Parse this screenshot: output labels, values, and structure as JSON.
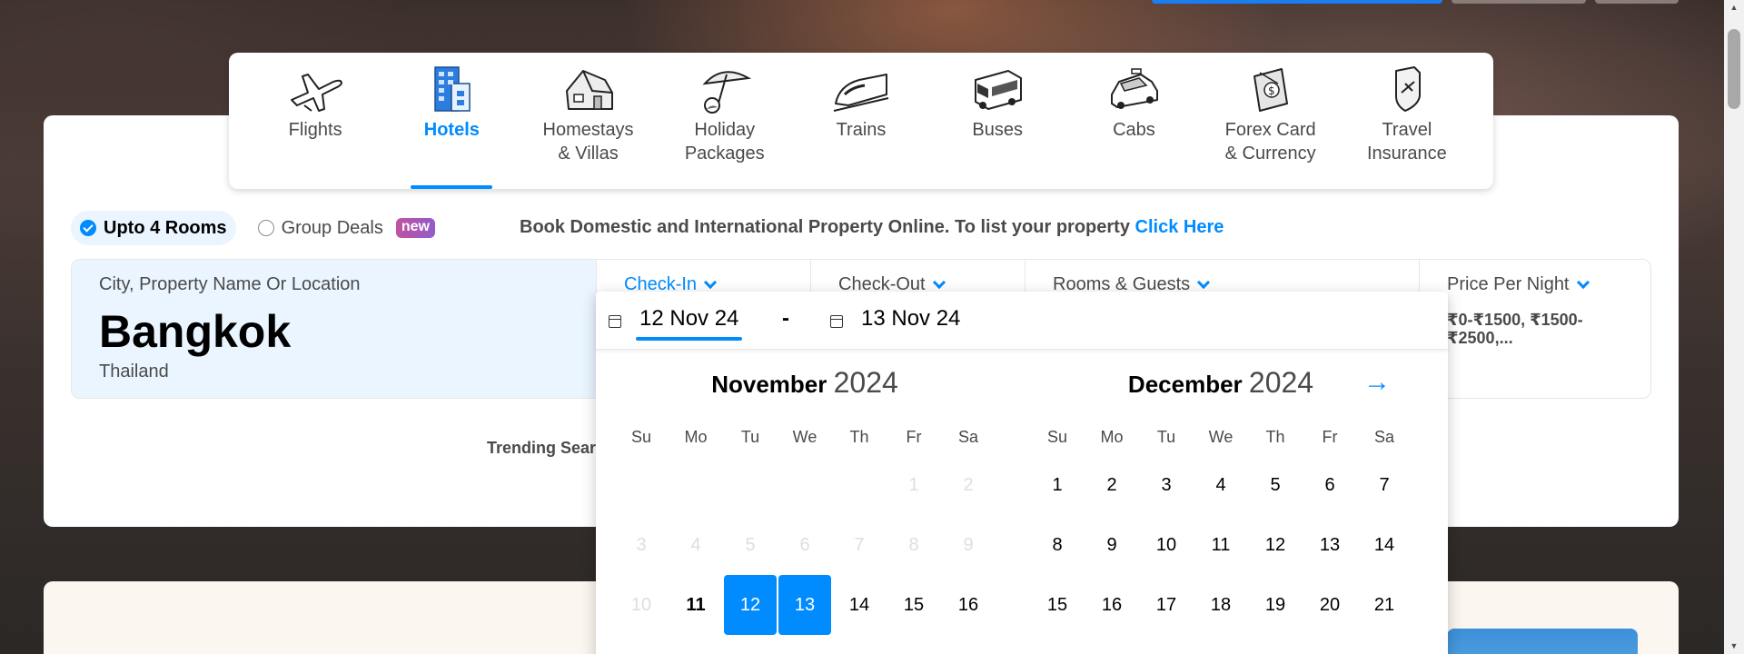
{
  "colors": {
    "accent": "#008cff",
    "pill_bg": "#eaf5ff",
    "text": "#4a4a4a"
  },
  "nav": {
    "tabs": [
      {
        "label": "Flights",
        "icon": "airplane-icon",
        "active": false
      },
      {
        "label": "Hotels",
        "icon": "hotel-building-icon",
        "active": true
      },
      {
        "label": "Homestays\n& Villas",
        "icon": "house-icon",
        "active": false
      },
      {
        "label": "Holiday\nPackages",
        "icon": "beach-umbrella-icon",
        "active": false
      },
      {
        "label": "Trains",
        "icon": "train-icon",
        "active": false
      },
      {
        "label": "Buses",
        "icon": "bus-icon",
        "active": false
      },
      {
        "label": "Cabs",
        "icon": "car-icon",
        "active": false
      },
      {
        "label": "Forex Card\n& Currency",
        "icon": "forex-card-icon",
        "active": false
      },
      {
        "label": "Travel\nInsurance",
        "icon": "insurance-shield-icon",
        "active": false
      }
    ]
  },
  "options": {
    "rooms_label": "Upto 4 Rooms",
    "group_label": "Group Deals",
    "new_badge": "new",
    "promo_text": "Book Domestic and International Property Online. To list your property",
    "promo_link": "Click Here"
  },
  "search": {
    "city_label": "City, Property Name Or Location",
    "city": "Bangkok",
    "country": "Thailand",
    "checkin_label": "Check-In",
    "checkout_label": "Check-Out",
    "rooms_label": "Rooms & Guests",
    "price_label": "Price Per Night",
    "price_value": "₹0-₹1500, ₹1500-₹2500,..."
  },
  "trending_label": "Trending Searc",
  "datepicker": {
    "checkin": "12 Nov 24",
    "separator": "-",
    "checkout": "13 Nov 24",
    "weekdays": [
      "Su",
      "Mo",
      "Tu",
      "We",
      "Th",
      "Fr",
      "Sa"
    ],
    "months": [
      {
        "name": "November",
        "year": "2024",
        "weeks": [
          [
            null,
            null,
            null,
            null,
            null,
            {
              "d": "1",
              "s": "disabled"
            },
            {
              "d": "2",
              "s": "disabled"
            }
          ],
          [
            {
              "d": "3",
              "s": "disabled"
            },
            {
              "d": "4",
              "s": "disabled"
            },
            {
              "d": "5",
              "s": "disabled"
            },
            {
              "d": "6",
              "s": "disabled"
            },
            {
              "d": "7",
              "s": "disabled"
            },
            {
              "d": "8",
              "s": "disabled"
            },
            {
              "d": "9",
              "s": "disabled"
            }
          ],
          [
            {
              "d": "10",
              "s": "disabled"
            },
            {
              "d": "11",
              "s": "today"
            },
            {
              "d": "12",
              "s": "selected"
            },
            {
              "d": "13",
              "s": "selected"
            },
            {
              "d": "14",
              "s": ""
            },
            {
              "d": "15",
              "s": ""
            },
            {
              "d": "16",
              "s": ""
            }
          ]
        ]
      },
      {
        "name": "December",
        "year": "2024",
        "weeks": [
          [
            {
              "d": "1",
              "s": ""
            },
            {
              "d": "2",
              "s": ""
            },
            {
              "d": "3",
              "s": ""
            },
            {
              "d": "4",
              "s": ""
            },
            {
              "d": "5",
              "s": ""
            },
            {
              "d": "6",
              "s": ""
            },
            {
              "d": "7",
              "s": ""
            }
          ],
          [
            {
              "d": "8",
              "s": ""
            },
            {
              "d": "9",
              "s": ""
            },
            {
              "d": "10",
              "s": ""
            },
            {
              "d": "11",
              "s": ""
            },
            {
              "d": "12",
              "s": ""
            },
            {
              "d": "13",
              "s": ""
            },
            {
              "d": "14",
              "s": ""
            }
          ],
          [
            {
              "d": "15",
              "s": ""
            },
            {
              "d": "16",
              "s": ""
            },
            {
              "d": "17",
              "s": ""
            },
            {
              "d": "18",
              "s": ""
            },
            {
              "d": "19",
              "s": ""
            },
            {
              "d": "20",
              "s": ""
            },
            {
              "d": "21",
              "s": ""
            }
          ]
        ]
      }
    ]
  }
}
